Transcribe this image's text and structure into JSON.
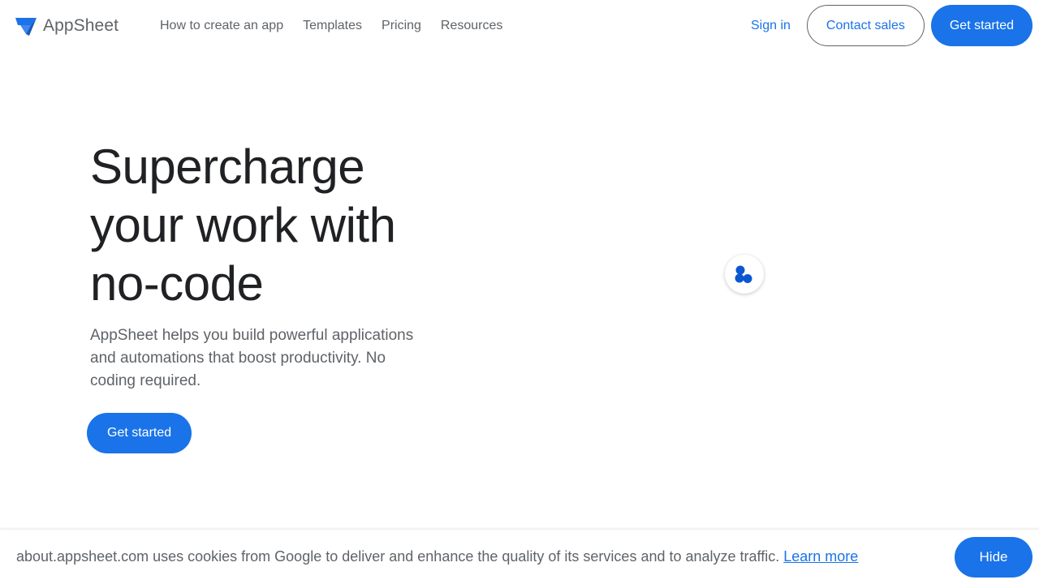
{
  "header": {
    "logo_text": "AppSheet",
    "logo_icon": "appsheet-logo-icon",
    "nav": [
      {
        "label": "How to create an app"
      },
      {
        "label": "Templates"
      },
      {
        "label": "Pricing"
      },
      {
        "label": "Resources"
      }
    ],
    "signin_label": "Sign in",
    "contact_label": "Contact sales",
    "get_started_label": "Get started"
  },
  "hero": {
    "title": "Supercharge your work with no-code",
    "subtitle": "AppSheet helps you build powerful applications and automations that boost productivity. No coding required.",
    "cta_label": "Get started"
  },
  "widget": {
    "icon": "loading-dots-icon"
  },
  "cookie": {
    "text": "about.appsheet.com uses cookies from Google to deliver and enhance the quality of its services and to analyze traffic.",
    "link_label": "Learn more",
    "hide_label": "Hide"
  },
  "colors": {
    "brand_blue": "#1a73e8",
    "text_dark": "#202124",
    "text_grey": "#5f6368",
    "loader_blue": "#0b57d0"
  }
}
